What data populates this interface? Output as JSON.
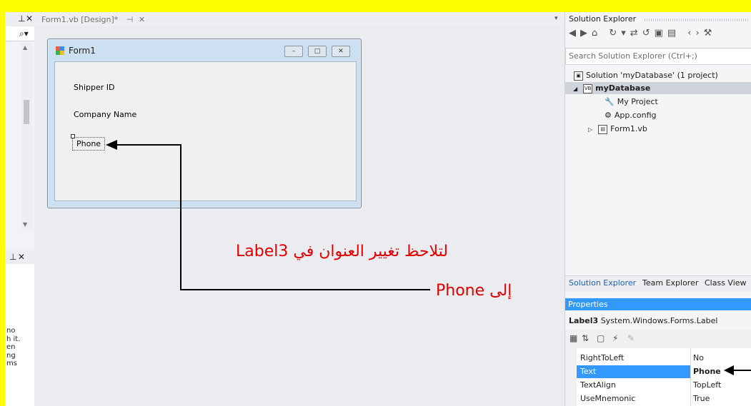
{
  "left_panel": {
    "pin_close": " ⨯ ✕",
    "search_glyph": "⌕ ▾",
    "pin_close_2": "⨯ ✕",
    "description_text": "no\nh it.\nen\nng\nms"
  },
  "document": {
    "tab_label": "Form1.vb [Design]*",
    "tab_pin": "⇥",
    "tab_close": "✕",
    "dropdown": "▾"
  },
  "form": {
    "title": "Form1",
    "minimize": "–",
    "maximize": "□",
    "close": "✕",
    "labels": [
      "Shipper ID",
      "Company Name",
      "Phone"
    ]
  },
  "annotation": {
    "line1": "لتلاحظ تغيير العنوان في    Label3",
    "line2": "إلى Phone",
    "color": "#e00000"
  },
  "solution_explorer": {
    "title": "Solution Explorer",
    "toolbar_glyphs": "◀▶⌂ ↻▾⇄↺▣▤ ‹›⚒",
    "search_placeholder": "Search Solution Explorer (Ctrl+;)",
    "tree": [
      {
        "label": "Solution 'myDatabase' (1 project)",
        "bold": false
      },
      {
        "label": "myDatabase",
        "bold": true
      },
      {
        "label": "My Project",
        "bold": false
      },
      {
        "label": "App.config",
        "bold": false
      },
      {
        "label": "Form1.vb",
        "bold": false
      }
    ],
    "tabs": [
      "Solution Explorer",
      "Team Explorer",
      "Class View"
    ]
  },
  "properties": {
    "title": "Properties",
    "object_name": "Label3",
    "object_type": "System.Windows.Forms.Label",
    "rows": [
      {
        "name": "RightToLeft",
        "value": "No",
        "selected": false
      },
      {
        "name": "Text",
        "value": "Phone",
        "selected": true
      },
      {
        "name": "TextAlign",
        "value": "TopLeft",
        "selected": false
      },
      {
        "name": "UseMnemonic",
        "value": "True",
        "selected": false
      }
    ]
  }
}
